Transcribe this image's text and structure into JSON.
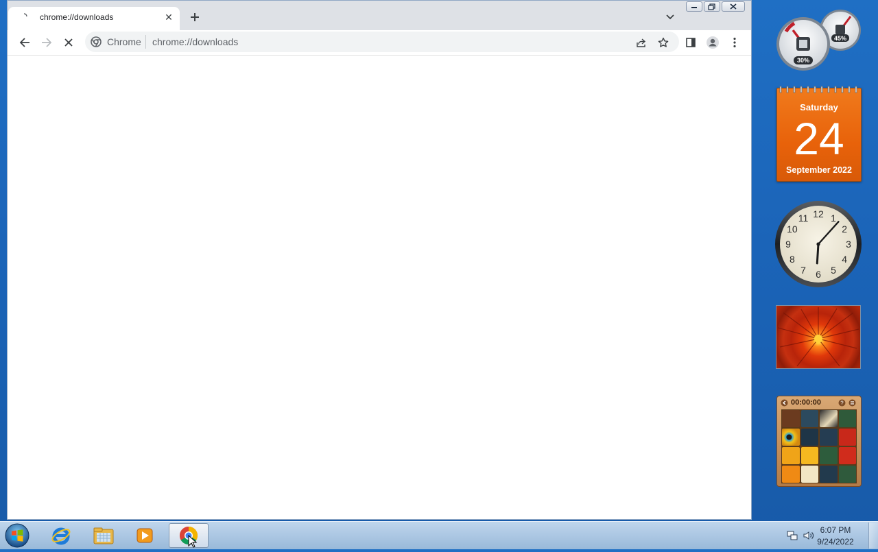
{
  "browser": {
    "tab": {
      "title": "chrome://downloads",
      "close_glyph": "✕"
    },
    "omnibox": {
      "site_chip": "Chrome",
      "url": "chrome://downloads"
    }
  },
  "icons": {
    "back": "back-arrow-icon",
    "forward": "forward-arrow-icon",
    "stop": "stop-loading-icon",
    "share": "share-icon",
    "bookmark": "star-icon",
    "side_panel": "side-panel-icon",
    "profile": "profile-icon",
    "menu": "kebab-menu-icon"
  },
  "gadgets": {
    "cpu_meter": {
      "cpu": "30%",
      "memory": "45%"
    },
    "calendar": {
      "day_name": "Saturday",
      "day_number": "24",
      "month_year": "September 2022"
    },
    "clock": {
      "numerals": [
        "12",
        "1",
        "2",
        "3",
        "4",
        "5",
        "6",
        "7",
        "8",
        "9",
        "10",
        "11"
      ],
      "hour": 18,
      "minute": 7
    },
    "puzzle": {
      "timer": "00:00:00"
    }
  },
  "taskbar": {
    "apps": [
      "internet-explorer",
      "windows-explorer",
      "media-player",
      "google-chrome"
    ],
    "clock": {
      "time": "6:07 PM",
      "date": "9/24/2022"
    }
  },
  "colors": {
    "desktop": "#1b64b8",
    "calendar": "#e8620a",
    "chrome_frame": "#dee1e6"
  }
}
